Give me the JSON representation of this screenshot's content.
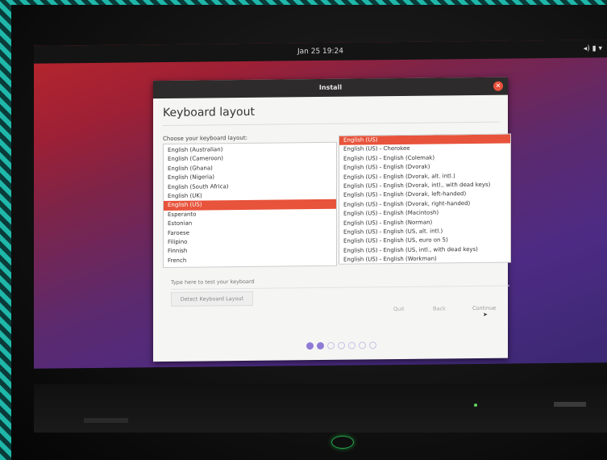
{
  "topbar": {
    "clock": "Jan 25  19:24",
    "system_icons": "◂) ▮ ▾"
  },
  "window": {
    "title": "Install",
    "close_glyph": "✕"
  },
  "page": {
    "heading": "Keyboard layout",
    "choose_label": "Choose your keyboard layout:",
    "test_placeholder": "Type here to test your keyboard",
    "detect_button": "Detect Keyboard Layout"
  },
  "layouts": [
    {
      "label": "English (Australian)",
      "selected": false
    },
    {
      "label": "English (Cameroon)",
      "selected": false
    },
    {
      "label": "English (Ghana)",
      "selected": false
    },
    {
      "label": "English (Nigeria)",
      "selected": false
    },
    {
      "label": "English (South Africa)",
      "selected": false
    },
    {
      "label": "English (UK)",
      "selected": false
    },
    {
      "label": "English (US)",
      "selected": true
    },
    {
      "label": "Esperanto",
      "selected": false
    },
    {
      "label": "Estonian",
      "selected": false
    },
    {
      "label": "Faroese",
      "selected": false
    },
    {
      "label": "Filipino",
      "selected": false
    },
    {
      "label": "Finnish",
      "selected": false
    },
    {
      "label": "French",
      "selected": false
    }
  ],
  "variants": [
    {
      "label": "English (US)",
      "selected": true
    },
    {
      "label": "English (US) - Cherokee",
      "selected": false
    },
    {
      "label": "English (US) - English (Colemak)",
      "selected": false
    },
    {
      "label": "English (US) - English (Dvorak)",
      "selected": false
    },
    {
      "label": "English (US) - English (Dvorak, alt. intl.)",
      "selected": false
    },
    {
      "label": "English (US) - English (Dvorak, intl., with dead keys)",
      "selected": false
    },
    {
      "label": "English (US) - English (Dvorak, left-handed)",
      "selected": false
    },
    {
      "label": "English (US) - English (Dvorak, right-handed)",
      "selected": false
    },
    {
      "label": "English (US) - English (Macintosh)",
      "selected": false
    },
    {
      "label": "English (US) - English (Norman)",
      "selected": false
    },
    {
      "label": "English (US) - English (US, alt. intl.)",
      "selected": false
    },
    {
      "label": "English (US) - English (US, euro on 5)",
      "selected": false
    },
    {
      "label": "English (US) - English (US, intl., with dead keys)",
      "selected": false
    },
    {
      "label": "English (US) - English (Workman)",
      "selected": false
    }
  ],
  "buttons": {
    "quit": "Quit",
    "back": "Back",
    "continue": "Continue"
  },
  "progress": {
    "total_steps": 7,
    "completed_steps": 2
  },
  "colors": {
    "selection": "#e8533b",
    "progress_dot": "#8f7bd6"
  }
}
